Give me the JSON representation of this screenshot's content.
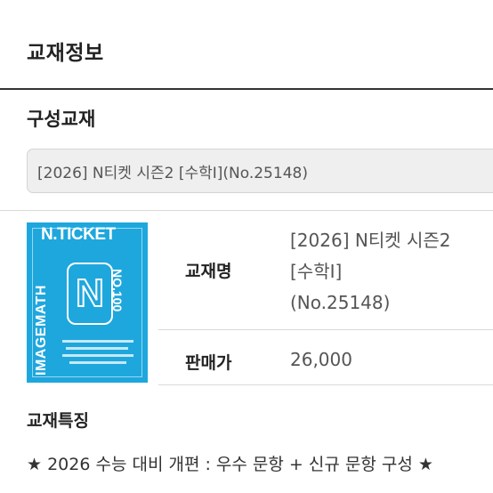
{
  "section": {
    "title": "교재정보"
  },
  "composition": {
    "label": "구성교재",
    "selected": "[2026] N티켓 시즌2 [수학Ⅰ](No.25148)"
  },
  "cover": {
    "brand": "N.TICKET",
    "side_left": "IMAGEMATH",
    "side_right": "NO.100",
    "emblem": "N",
    "accent_color": "#1ea7dd"
  },
  "details": {
    "name_label": "교재명",
    "name_value_lines": [
      "[2026] N티켓 시즌2",
      "[수학Ⅰ]",
      "(No.25148)"
    ],
    "price_label": "판매가",
    "price_value": "26,000"
  },
  "features": {
    "label": "교재특징",
    "text": "★ 2026 수능 대비 개편 : 우수 문항 + 신규 문항 구성 ★"
  }
}
